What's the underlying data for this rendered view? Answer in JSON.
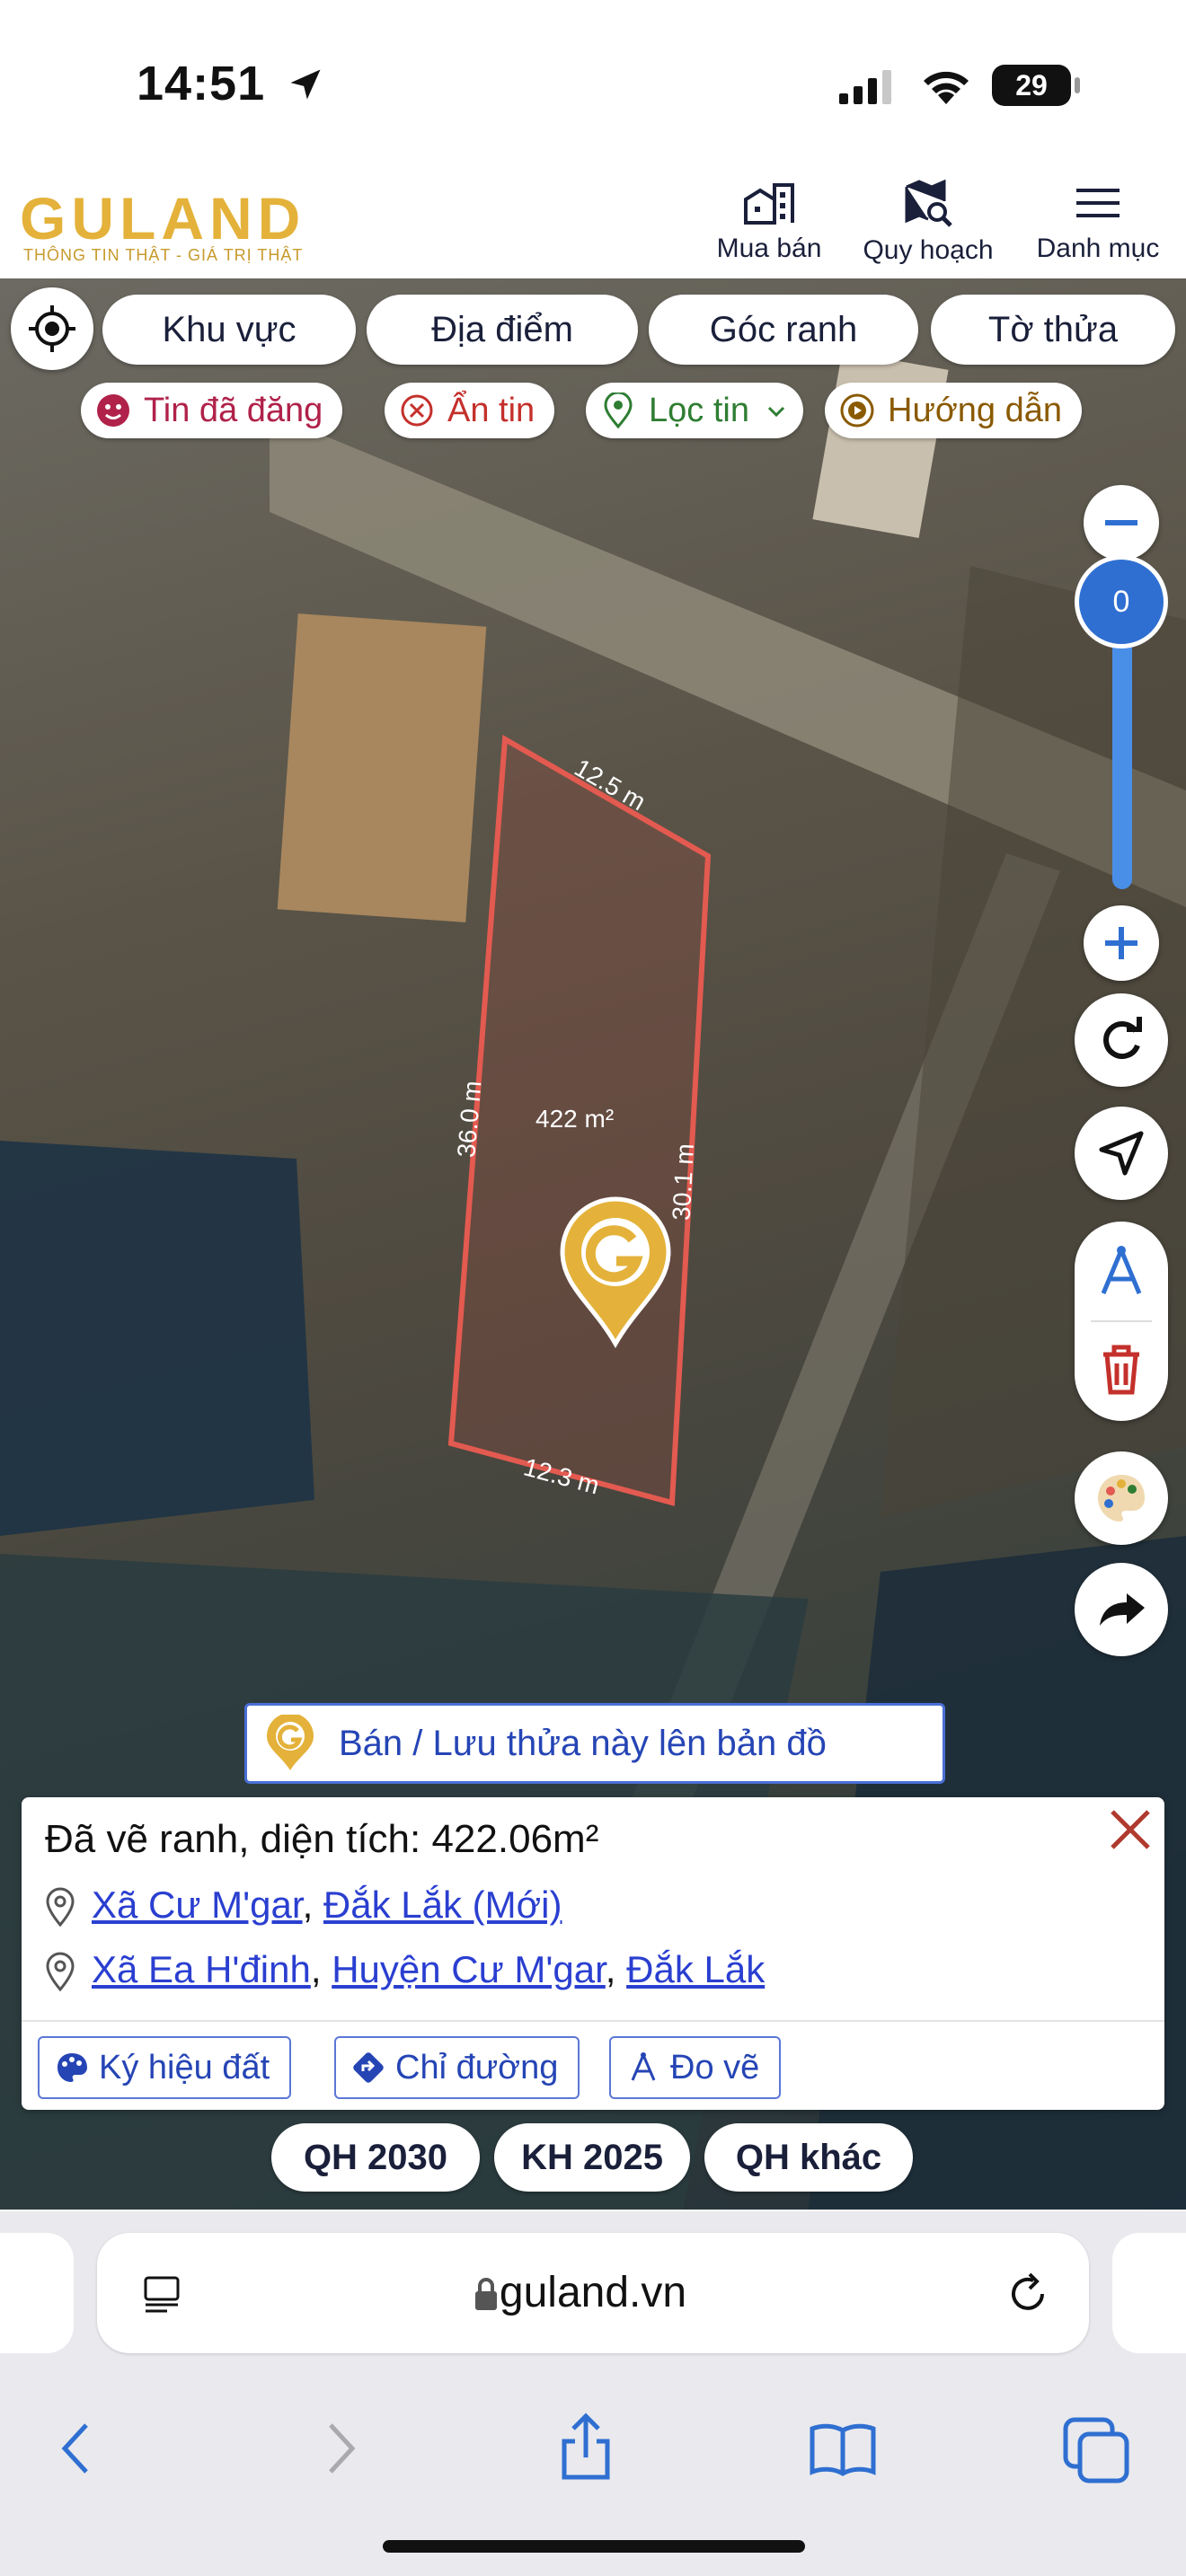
{
  "status": {
    "time": "14:51",
    "battery": "29"
  },
  "header": {
    "logo": "GULAND",
    "logo_sub": "THÔNG TIN THẬT - GIÁ TRỊ THẬT",
    "nav": [
      {
        "label": "Mua bán",
        "icon": "building-icon"
      },
      {
        "label": "Quy hoạch",
        "icon": "map-search-icon"
      },
      {
        "label": "Danh mục",
        "icon": "menu-icon"
      }
    ]
  },
  "map": {
    "top_tabs": [
      "Khu vực",
      "Địa điểm",
      "Góc ranh",
      "Tờ thửa"
    ],
    "filters": [
      {
        "label": "Tin đã đăng",
        "color": "#B0224A"
      },
      {
        "label": "Ẩn tin",
        "color": "#C4302B"
      },
      {
        "label": "Lọc tin",
        "color": "#2E7D32"
      },
      {
        "label": "Hướng dẫn",
        "color": "#8A5A00"
      }
    ],
    "zoom_value": "0",
    "parcel": {
      "edge_top": "12.5 m",
      "edge_left": "36.0 m",
      "edge_right": "30.1 m",
      "edge_bottom": "12.3 m",
      "area_label": "422 m²"
    },
    "sell_button": "Bán / Lưu thửa này lên bản đồ"
  },
  "panel": {
    "title": "Đã vẽ ranh, diện tích: 422.06m²",
    "loc1": [
      "Xã Cư M'gar",
      "Đắk Lắk (Mới)"
    ],
    "loc2": [
      "Xã Ea H'đinh",
      "Huyện Cư M'gar",
      "Đắk Lắk"
    ],
    "actions": [
      "Ký hiệu đất",
      "Chỉ đường",
      "Đo vẽ"
    ]
  },
  "plans": [
    "QH 2030",
    "KH 2025",
    "QH khác"
  ],
  "browser": {
    "url": "guland.vn"
  },
  "colors": {
    "brand": "#E4B23A",
    "link": "#2a3fd0",
    "parcel": "#E35A50",
    "zoom": "#2F6FD1"
  }
}
